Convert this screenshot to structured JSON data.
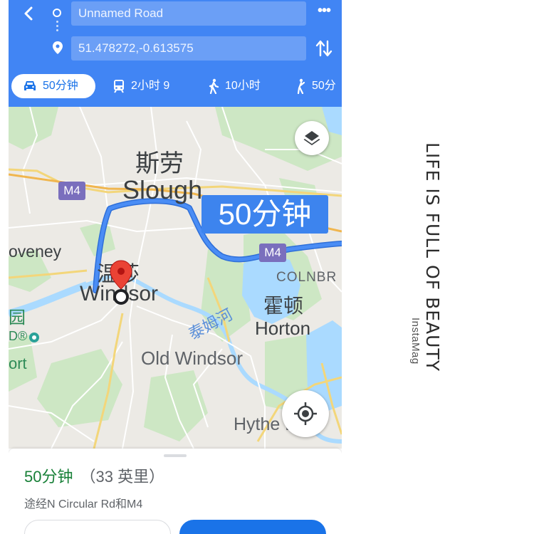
{
  "header": {
    "from": "Unnamed Road",
    "to": "51.478272,-0.613575",
    "modes": [
      {
        "icon": "car-icon",
        "label": "50分钟",
        "selected": true
      },
      {
        "icon": "train-icon",
        "label": "2小时 9"
      },
      {
        "icon": "walk-icon",
        "label": "10小时"
      },
      {
        "icon": "ride-icon",
        "label": "50分"
      }
    ]
  },
  "map": {
    "time_bubble": "50分钟",
    "labels": {
      "slough_cn": "斯劳",
      "slough": "Slough",
      "dorney": "oveney",
      "windsor_cn": "温莎",
      "windsor": "Windsor",
      "thames_cn": "泰姆河",
      "horton_cn": "霍顿",
      "horton": "Horton",
      "colnbrook": "COLNBR",
      "old_windsor": "Old Windsor",
      "hythe_end": "Hythe End",
      "park_cn": "园",
      "park_frag": "D®",
      "port_frag": "ort"
    },
    "road_shields": [
      "M4",
      "M4"
    ],
    "colors": {
      "route": "#4285f4",
      "water": "#aadaff",
      "green": "#c8e6c0",
      "pin": "#ea4335"
    }
  },
  "sheet": {
    "time": "50分钟",
    "distance": "（33 英里）",
    "via": "途经N Circular Rd和M4"
  },
  "decor": {
    "main": "LIFE IS FULL OF BEAUTY",
    "sub": "InstaMag"
  }
}
